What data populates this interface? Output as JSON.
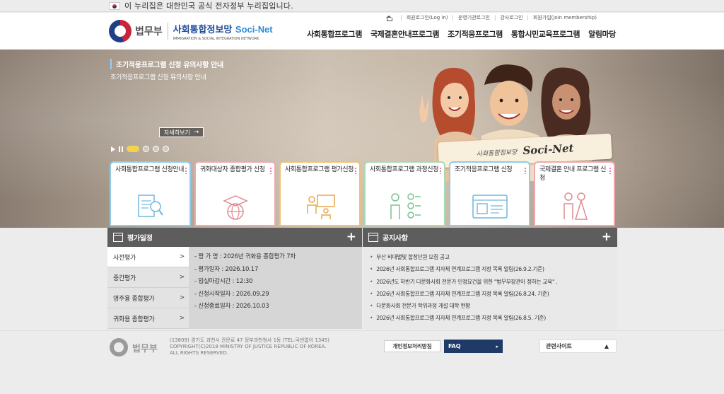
{
  "gov_banner": {
    "text": "이 누리집은 대한민국 공식 전자정부 누리집입니다."
  },
  "header": {
    "ministry": "법무부",
    "site_title_kr": "사회통합정보망",
    "site_title_en": "Soci-Net",
    "site_subtitle": "IMMIGRATION & SOCIAL INTEGRATION NETWORK",
    "util_links": [
      "회원로그인(Log in)",
      "운영기관로그인",
      "강사로그인",
      "회원가입(join membership)"
    ],
    "nav": [
      "사회통합프로그램",
      "국제결혼안내프로그램",
      "조기적응프로그램",
      "통합시민교육프로그램",
      "알림마당"
    ]
  },
  "hero": {
    "title": "조기적응프로그램 신청 유의사항 안내",
    "subtitle": "조기적응프로그램 신청 유의사항 안내",
    "more_label": "자세히보기",
    "banner_kr": "사회통합정보망",
    "banner_en": "Soci-Net"
  },
  "quick_cards": [
    {
      "label": "사회통합프로그램 신청안내",
      "icon": "document-search-icon"
    },
    {
      "label": "귀화대상자 종합평가 신청",
      "icon": "graduation-globe-icon"
    },
    {
      "label": "사회통합프로그램 평가신청",
      "icon": "classroom-icon"
    },
    {
      "label": "사회통합프로그램 과정신청",
      "icon": "checklist-icon"
    },
    {
      "label": "조기적응프로그램 신청",
      "icon": "id-card-icon"
    },
    {
      "label": "국제결혼 안내 프로그램 신청",
      "icon": "couple-icon"
    }
  ],
  "eval": {
    "title": "평가일정",
    "tabs": [
      "사전평가",
      "중간평가",
      "영주용 종합평가",
      "귀화용 종합평가"
    ],
    "details": [
      "- 평 가 명 : 2026년 귀화용 종합평가 7차",
      "- 평가일자 : 2026.10.17",
      "- 입실마감시간 : 12:30",
      "- 신청시작일자 : 2026.09.29",
      "- 신청종료일자 : 2026.10.03"
    ]
  },
  "notice": {
    "title": "공지사항",
    "items": [
      "부산 비대별빛 합창단원 모집 공고",
      "2026년 사회통합프로그램 지자체 연계프로그램 지정 목록 알림(26.9.2.기준)",
      "2026년도 하반기 다문화사회 전문가 인정요건을 위한 \"법무부장관이 정하는 교육\" .",
      "2026년 사회통합프로그램 지자체 연계프로그램 지정 목록 알림(26.8.24. 기준)",
      "다문화사회 전문가 학위과정 개설 대학 현황",
      "2026년 사회통합프로그램 지자체 연계프로그램 지정 목록 알림(26.8.5. 기준)"
    ]
  },
  "footer": {
    "ministry": "법무부",
    "address": "(13809) 경기도 과천시 관문로 47 정부과천청사 1동 (TEL:국번없이 1345)",
    "copyright": "COPYRIGHT(C)2018 MINISTRY OF JUSTICE REPUBLIC OF KOREA.",
    "rights": "ALL RIGHTS RESERVED.",
    "privacy_label": "개인정보처리방침",
    "faq_label": "FAQ",
    "related_label": "관련사이트"
  }
}
